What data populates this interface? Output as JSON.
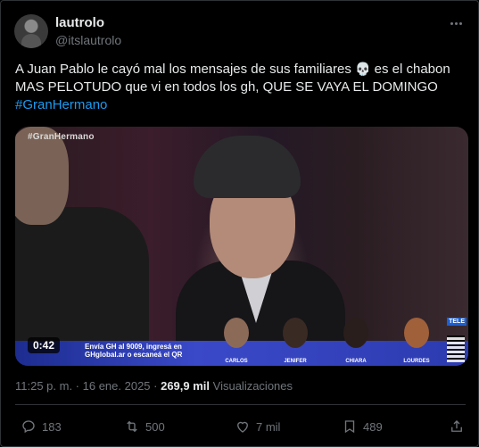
{
  "author": {
    "name": "lautrolo",
    "handle": "@itslautrolo"
  },
  "tweet": {
    "text_part1": "A Juan Pablo le cayó mal los mensajes de sus familiares ",
    "skull": "💀",
    "text_part2": " es el chabon MAS PELOTUDO que vi en todos los gh, QUE SE VAYA EL DOMINGO",
    "hashtag": "#GranHermano"
  },
  "media": {
    "tag": "#GranHermano",
    "duration": "0:42",
    "ticker_line1": "Envía GH al 9009, ingresá en",
    "ticker_line2": "GHglobal.ar o escaneá el QR",
    "tele": "TELE",
    "contestants": [
      "CARLOS",
      "JENIFER",
      "CHIARA",
      "LOURDES"
    ]
  },
  "meta": {
    "time_date": "11:25 p. m. · 16 ene. 2025 · ",
    "views_count": "269,9 mil",
    "views_label": " Visualizaciones"
  },
  "actions": {
    "replies": "183",
    "retweets": "500",
    "likes": "7 mil",
    "bookmarks": "489"
  },
  "colors": {
    "accent": "#1d9bf0",
    "muted": "#71767b",
    "background": "#000000"
  }
}
